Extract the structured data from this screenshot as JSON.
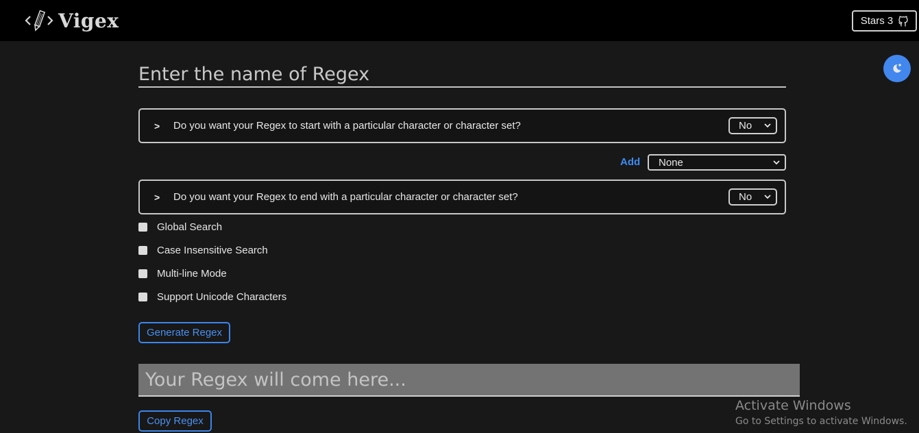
{
  "app": {
    "name": "Vigex",
    "stars_label": "Stars 3"
  },
  "form": {
    "name_placeholder": "Enter the name of Regex",
    "questions": [
      {
        "chevron": ">",
        "text": "Do you want your Regex to start with a particular character or character set?",
        "selected": "No"
      },
      {
        "chevron": ">",
        "text": "Do you want your Regex to end with a particular character or character set?",
        "selected": "No"
      }
    ],
    "add": {
      "label": "Add",
      "selected": "None"
    },
    "options": [
      {
        "label": "Global Search",
        "checked": false
      },
      {
        "label": "Case Insensitive Search",
        "checked": false
      },
      {
        "label": "Multi-line Mode",
        "checked": false
      },
      {
        "label": "Support Unicode Characters",
        "checked": false
      }
    ],
    "generate_label": "Generate Regex",
    "output_placeholder": "Your Regex will come here...",
    "copy_label": "Copy Regex"
  },
  "watermark": {
    "title": "Activate Windows",
    "subtitle": "Go to Settings to activate Windows."
  },
  "colors": {
    "accent": "#3d8bf2",
    "theme_button": "#4287ee",
    "background": "#181818",
    "navbar": "#000000"
  }
}
